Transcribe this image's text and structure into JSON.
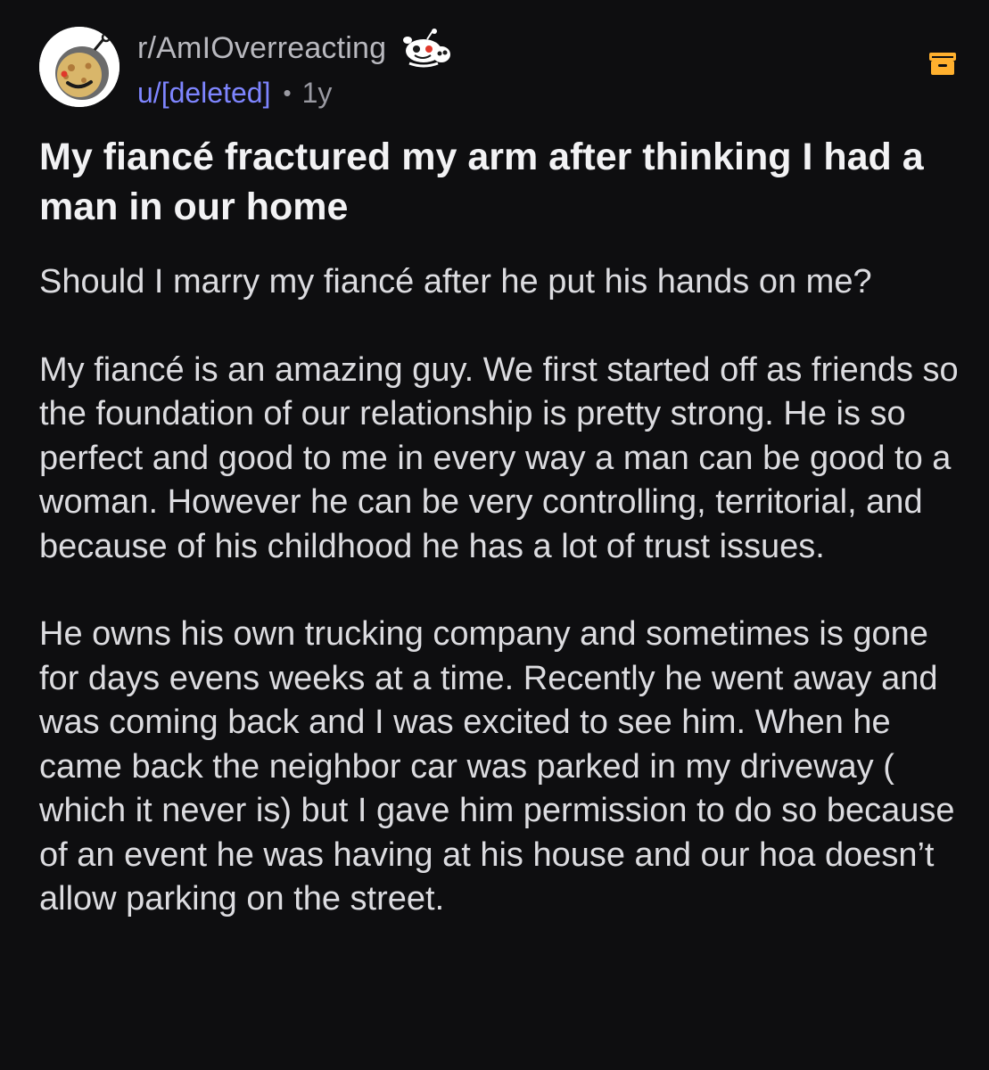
{
  "post": {
    "subreddit": "r/AmIOverreacting",
    "username": "u/[deleted]",
    "separator": "•",
    "age": "1y",
    "title": "My fiancé fractured my arm after thinking I had a man in our home",
    "paragraphs": [
      "Should I marry my fiancé after he put his hands on me?",
      "My fiancé is an amazing guy. We first started off as friends so the foundation of our relationship is pretty strong. He is so perfect and good to me in every way a man can be good to a woman. However he can be very controlling, territorial, and because of his childhood he has a lot of trust issues.",
      "He owns his own trucking company and sometimes is gone for days evens weeks at a time. Recently he went away and was coming back and I was excited to see him. When he came back the neighbor car was parked in my driveway ( which it never is) but I gave him permission to do so because of an event he was having at his house and our hoa doesn’t allow parking on the street."
    ]
  },
  "icons": {
    "avatar": "subreddit-avatar-icon",
    "mascot": "reddit-snoo-mascot-icon",
    "archive": "archive-box-icon"
  },
  "colors": {
    "background": "#0e0e10",
    "username": "#7e85ff",
    "archive": "#ffb02e"
  }
}
